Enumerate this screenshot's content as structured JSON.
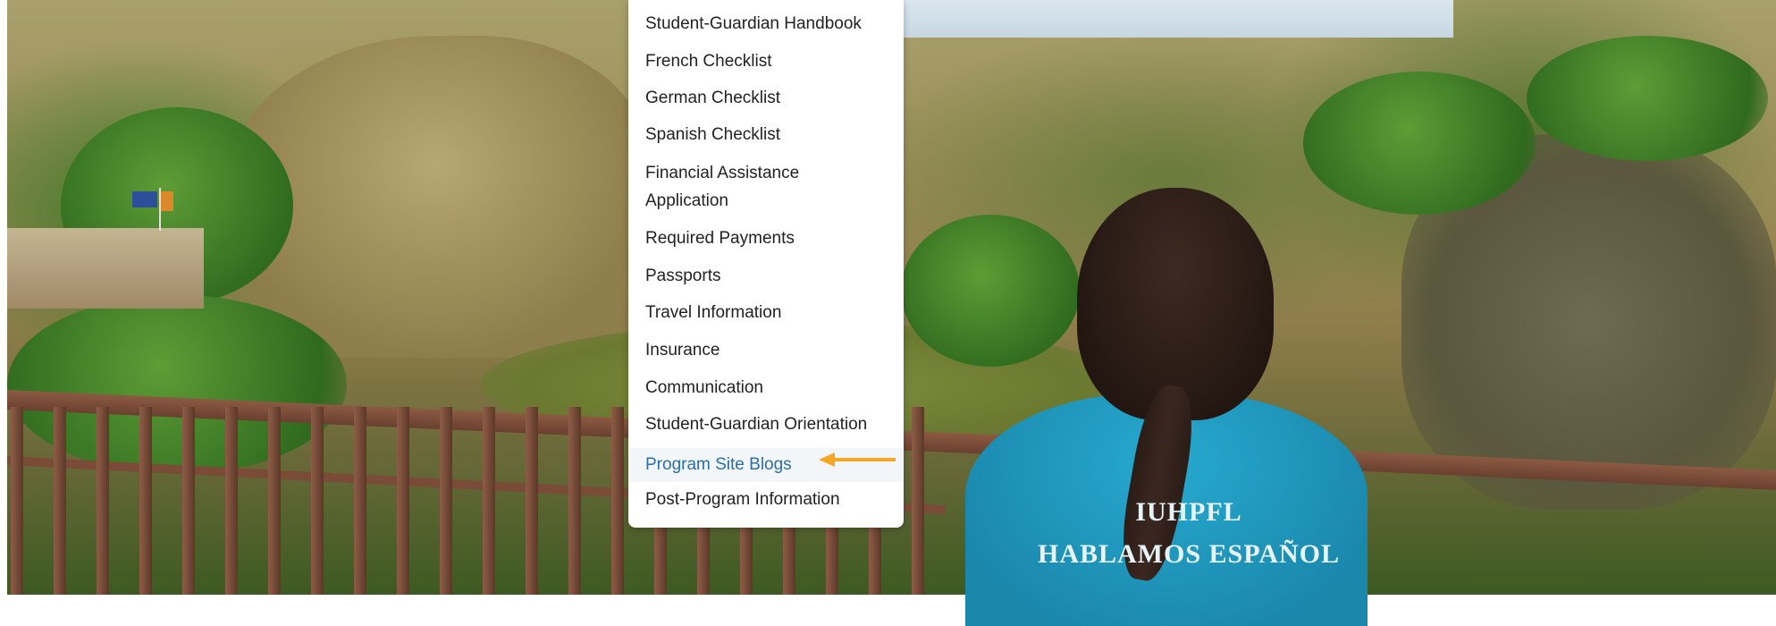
{
  "menu": {
    "items": [
      {
        "label": "Student-Guardian Handbook"
      },
      {
        "label": "French Checklist"
      },
      {
        "label": "German Checklist"
      },
      {
        "label": "Spanish Checklist"
      },
      {
        "label_line1": "Financial Assistance",
        "label_line2": "Application"
      },
      {
        "label": "Required Payments"
      },
      {
        "label": "Passports"
      },
      {
        "label": "Travel Information"
      },
      {
        "label": "Insurance"
      },
      {
        "label": "Communication"
      },
      {
        "label": "Student-Guardian Orientation"
      },
      {
        "label": "Program Site Blogs",
        "highlighted": true
      },
      {
        "label": "Post-Program Information"
      }
    ],
    "highlight_color": "#2a6ea6",
    "text_color": "#222222"
  },
  "annotation": {
    "arrow_color": "#f5a623",
    "points_to": "Program Site Blogs"
  },
  "background_photo": {
    "shirt_text_line1": "IUHPFL",
    "shirt_text_line2": "HABLAMOS ESPAÑOL"
  }
}
